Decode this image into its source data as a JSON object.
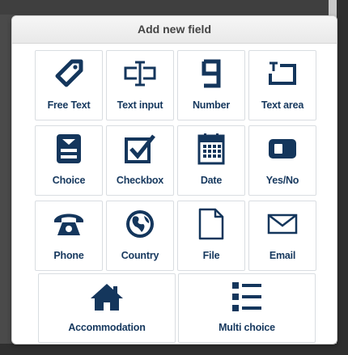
{
  "dialog": {
    "title": "Add new field"
  },
  "fields": [
    {
      "label": "Free Text",
      "icon": "tag-icon"
    },
    {
      "label": "Text input",
      "icon": "text-cursor-icon"
    },
    {
      "label": "Number",
      "icon": "digit-nine-icon"
    },
    {
      "label": "Text area",
      "icon": "text-area-icon"
    },
    {
      "label": "Choice",
      "icon": "dropdown-list-icon"
    },
    {
      "label": "Checkbox",
      "icon": "checkbox-icon"
    },
    {
      "label": "Date",
      "icon": "calendar-icon"
    },
    {
      "label": "Yes/No",
      "icon": "toggle-icon"
    },
    {
      "label": "Phone",
      "icon": "telephone-icon"
    },
    {
      "label": "Country",
      "icon": "globe-icon"
    },
    {
      "label": "File",
      "icon": "file-icon"
    },
    {
      "label": "Email",
      "icon": "envelope-icon"
    },
    {
      "label": "Accommodation",
      "icon": "house-icon"
    },
    {
      "label": "Multi choice",
      "icon": "bullet-list-icon"
    }
  ],
  "colors": {
    "icon": "#14365c",
    "label": "#16385e"
  }
}
